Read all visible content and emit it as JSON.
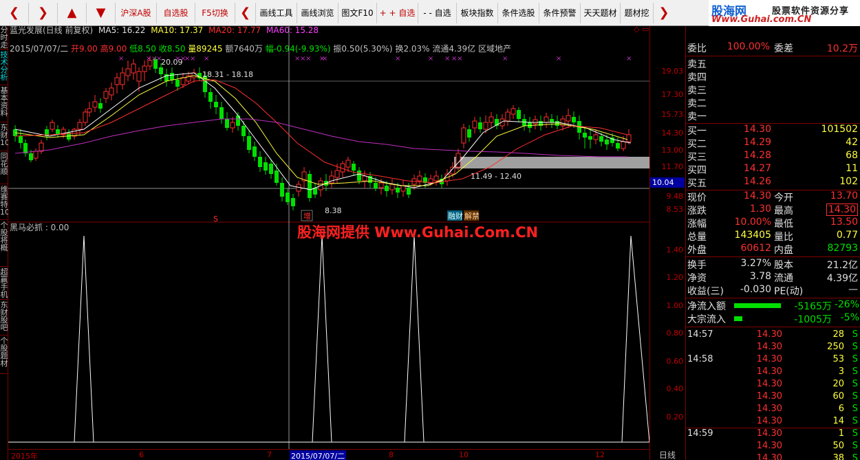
{
  "toolbar": {
    "market_btn": "沪深A股",
    "watchlist_btn": "自选股",
    "f5_btn": "F5切换",
    "draw_tool": "画线工具",
    "draw_browse": "画线浏览",
    "f10_btn": "图文F10",
    "add_watch": "+ + 自选",
    "remove_watch": "- - 自选",
    "sector_index": "板块指数",
    "condition_select": "条件选股",
    "condition_alert": "条件预警",
    "daily_topic": "天天题材",
    "topic_dig": "题材挖"
  },
  "logo": {
    "brand": "股海网",
    "slogan": "股票软件资源分享",
    "url": "Www.Guhai.com.CN"
  },
  "left_tabs": [
    "分时走势",
    "技术分析",
    "基本资料",
    "东财10",
    "同花顺",
    "维赛特10",
    "个股将概",
    "超赢手机",
    "东财股吧",
    "个股题材"
  ],
  "header": {
    "stock": "蓝光发展(日线 前复权)",
    "ma5": "MA5: 16.22",
    "ma10": "MA10: 17.37",
    "ma20": "MA20: 17.77",
    "ma60": "MA60: 15.28",
    "date": "2015/07/07/二",
    "open": "开9.00",
    "high": "高9.00",
    "low": "低8.50",
    "close": "收8.50",
    "vol": "量89245",
    "amount": "额7640万",
    "change": "幅-0.94(-9.93%)",
    "amplitude": "振0.50(5.30%)",
    "turnover": "换2.03%",
    "float": "流通4.39亿",
    "region": "区域地产"
  },
  "annotations": {
    "high_label": "20.09",
    "range1": "18.31 - 18.18",
    "range2": "11.49 - 12.40",
    "low_label": "8.38",
    "zeng": "增",
    "fin": "融财",
    "limit": "解禁",
    "s_mark": "S"
  },
  "indicator": {
    "name": "黑马必抓 : 0.00"
  },
  "price_axis": [
    "19.03",
    "17.30",
    "15.73",
    "14.30",
    "13.00",
    "11.70",
    "9.48",
    "8.53"
  ],
  "current_price": "10.04",
  "sub_axis": [
    "1.40",
    "1.20",
    "1.00",
    "0.80",
    "0.60",
    "0.40",
    "0.20"
  ],
  "x_axis": [
    "2015年",
    "6",
    "7",
    "2015/07/07/二",
    "8",
    "10",
    "12"
  ],
  "period_btn": "日线",
  "watermark": "股海网提供 Www.Guhai.Com.CN",
  "right": {
    "weibi_lbl": "委比",
    "weibi": "100.00%",
    "weicha_lbl": "委差",
    "weicha": "10.2万",
    "asks": [
      {
        "label": "卖五",
        "price": "",
        "vol": ""
      },
      {
        "label": "卖四",
        "price": "",
        "vol": ""
      },
      {
        "label": "卖三",
        "price": "",
        "vol": ""
      },
      {
        "label": "卖二",
        "price": "",
        "vol": ""
      },
      {
        "label": "卖一",
        "price": "",
        "vol": ""
      }
    ],
    "bids": [
      {
        "label": "买一",
        "price": "14.30",
        "vol": "101502"
      },
      {
        "label": "买二",
        "price": "14.29",
        "vol": "42"
      },
      {
        "label": "买三",
        "price": "14.28",
        "vol": "68"
      },
      {
        "label": "买四",
        "price": "14.27",
        "vol": "11"
      },
      {
        "label": "买五",
        "price": "14.26",
        "vol": "102"
      }
    ],
    "stats": [
      {
        "l1": "现价",
        "v1": "14.30",
        "l2": "今开",
        "v2": "13.70"
      },
      {
        "l1": "涨跌",
        "v1": "1.30",
        "l2": "最高",
        "v2": "14.30"
      },
      {
        "l1": "涨幅",
        "v1": "10.00%",
        "l2": "最低",
        "v2": "13.50"
      },
      {
        "l1": "总量",
        "v1": "143405",
        "l2": "量比",
        "v2": "0.77"
      },
      {
        "l1": "外盘",
        "v1": "60612",
        "l2": "内盘",
        "v2": "82793"
      }
    ],
    "stats2": [
      {
        "l1": "换手",
        "v1": "3.27%",
        "l2": "股本",
        "v2": "21.2亿"
      },
      {
        "l1": "净资",
        "v1": "3.78",
        "l2": "流通",
        "v2": "4.39亿"
      },
      {
        "l1": "收益(三)",
        "v1": "-0.030",
        "l2": "PE(动)",
        "v2": "—"
      }
    ],
    "flow": [
      {
        "label": "净流入额",
        "value": "-5165万",
        "pct": "-26%"
      },
      {
        "label": "大宗流入",
        "value": "-1005万",
        "pct": "-5%"
      }
    ],
    "ticks": [
      {
        "time": "14:57",
        "price": "14.30",
        "vol": "28",
        "side": "S"
      },
      {
        "time": "",
        "price": "14.30",
        "vol": "250",
        "side": "S"
      },
      {
        "time": "14:58",
        "price": "14.30",
        "vol": "53",
        "side": "S"
      },
      {
        "time": "",
        "price": "14.30",
        "vol": "3",
        "side": "S"
      },
      {
        "time": "",
        "price": "14.30",
        "vol": "20",
        "side": "S"
      },
      {
        "time": "",
        "price": "14.30",
        "vol": "60",
        "side": "S"
      },
      {
        "time": "",
        "price": "14.30",
        "vol": "6",
        "side": "S"
      },
      {
        "time": "",
        "price": "14.30",
        "vol": "14",
        "side": "S"
      },
      {
        "time": "14:59",
        "price": "14.30",
        "vol": "1",
        "side": "S"
      },
      {
        "time": "",
        "price": "14.30",
        "vol": "50",
        "side": "S"
      },
      {
        "time": "",
        "price": "14.30",
        "vol": "38",
        "side": "S"
      }
    ]
  },
  "colors": {
    "up": "#ff3030",
    "down": "#00e000",
    "ma5": "#ffffff",
    "ma10": "#ffff40",
    "ma20": "#ff3030",
    "ma60": "#c030c0"
  }
}
